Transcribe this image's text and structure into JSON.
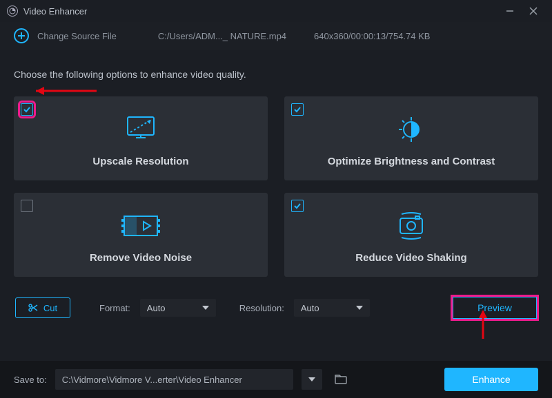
{
  "window": {
    "title": "Video Enhancer"
  },
  "header": {
    "change_source": "Change Source File",
    "file_path": "C:/Users/ADM..._ NATURE.mp4",
    "file_meta": "640x360/00:00:13/754.74 KB"
  },
  "instruction": "Choose the following options to enhance video quality.",
  "cards": {
    "upscale": {
      "label": "Upscale Resolution",
      "checked": true
    },
    "brightness": {
      "label": "Optimize Brightness and Contrast",
      "checked": true
    },
    "noise": {
      "label": "Remove Video Noise",
      "checked": false
    },
    "shaking": {
      "label": "Reduce Video Shaking",
      "checked": true
    }
  },
  "controls": {
    "cut": "Cut",
    "format_label": "Format:",
    "format_value": "Auto",
    "resolution_label": "Resolution:",
    "resolution_value": "Auto",
    "preview": "Preview"
  },
  "footer": {
    "save_to_label": "Save to:",
    "save_path": "C:\\Vidmore\\Vidmore V...erter\\Video Enhancer",
    "enhance": "Enhance"
  }
}
